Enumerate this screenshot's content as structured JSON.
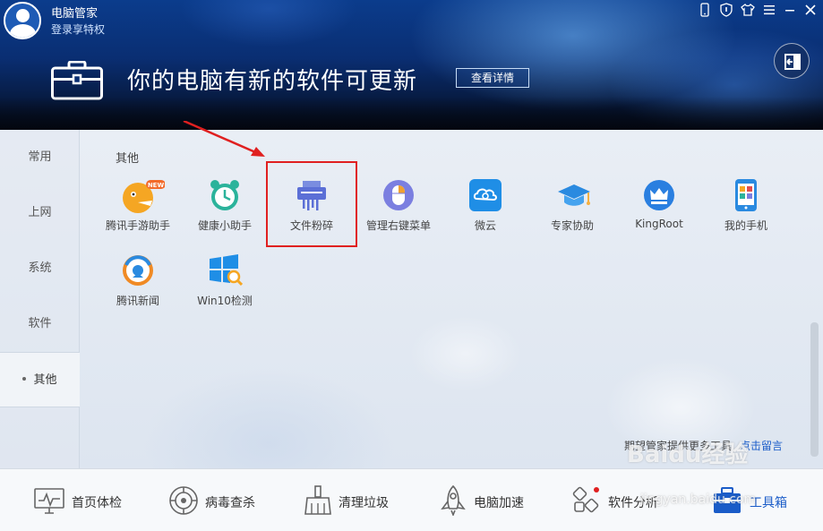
{
  "header": {
    "app_name": "电脑管家",
    "login_link": "登录享特权",
    "headline": "你的电脑有新的软件可更新",
    "details_button": "查看详情"
  },
  "sidebar": {
    "items": [
      {
        "label": "常用"
      },
      {
        "label": "上网"
      },
      {
        "label": "系统"
      },
      {
        "label": "软件"
      },
      {
        "label": "其他"
      }
    ],
    "active": "其他"
  },
  "main": {
    "section_title": "其他",
    "tools": [
      {
        "label": "腾讯手游助手",
        "icon": "game-assistant-icon",
        "badge": "NEW"
      },
      {
        "label": "健康小助手",
        "icon": "alarm-clock-icon"
      },
      {
        "label": "文件粉碎",
        "icon": "shredder-icon"
      },
      {
        "label": "管理右键菜单",
        "icon": "mouse-icon"
      },
      {
        "label": "微云",
        "icon": "weiyun-cloud-icon"
      },
      {
        "label": "专家协助",
        "icon": "graduation-cap-icon"
      },
      {
        "label": "KingRoot",
        "icon": "crown-icon"
      },
      {
        "label": "我的手机",
        "icon": "phone-icon"
      },
      {
        "label": "腾讯新闻",
        "icon": "news-icon"
      },
      {
        "label": "Win10检测",
        "icon": "windows-check-icon"
      }
    ],
    "footer_hint": "期望管家提供更多工具",
    "footer_link": "点击留言"
  },
  "bottom_nav": [
    {
      "label": "首页体检",
      "icon": "monitor-checkup-icon"
    },
    {
      "label": "病毒查杀",
      "icon": "virus-scan-icon"
    },
    {
      "label": "清理垃圾",
      "icon": "broom-icon"
    },
    {
      "label": "电脑加速",
      "icon": "rocket-icon"
    },
    {
      "label": "软件分析",
      "icon": "software-analysis-icon"
    },
    {
      "label": "工具箱",
      "icon": "toolbox-icon"
    }
  ],
  "watermark": {
    "text": "Baidu经验",
    "url_text": "jingyan.baidu.com"
  },
  "colors": {
    "accent": "#1a5cc8",
    "highlight": "#e02020",
    "header_dark": "#071c44"
  }
}
